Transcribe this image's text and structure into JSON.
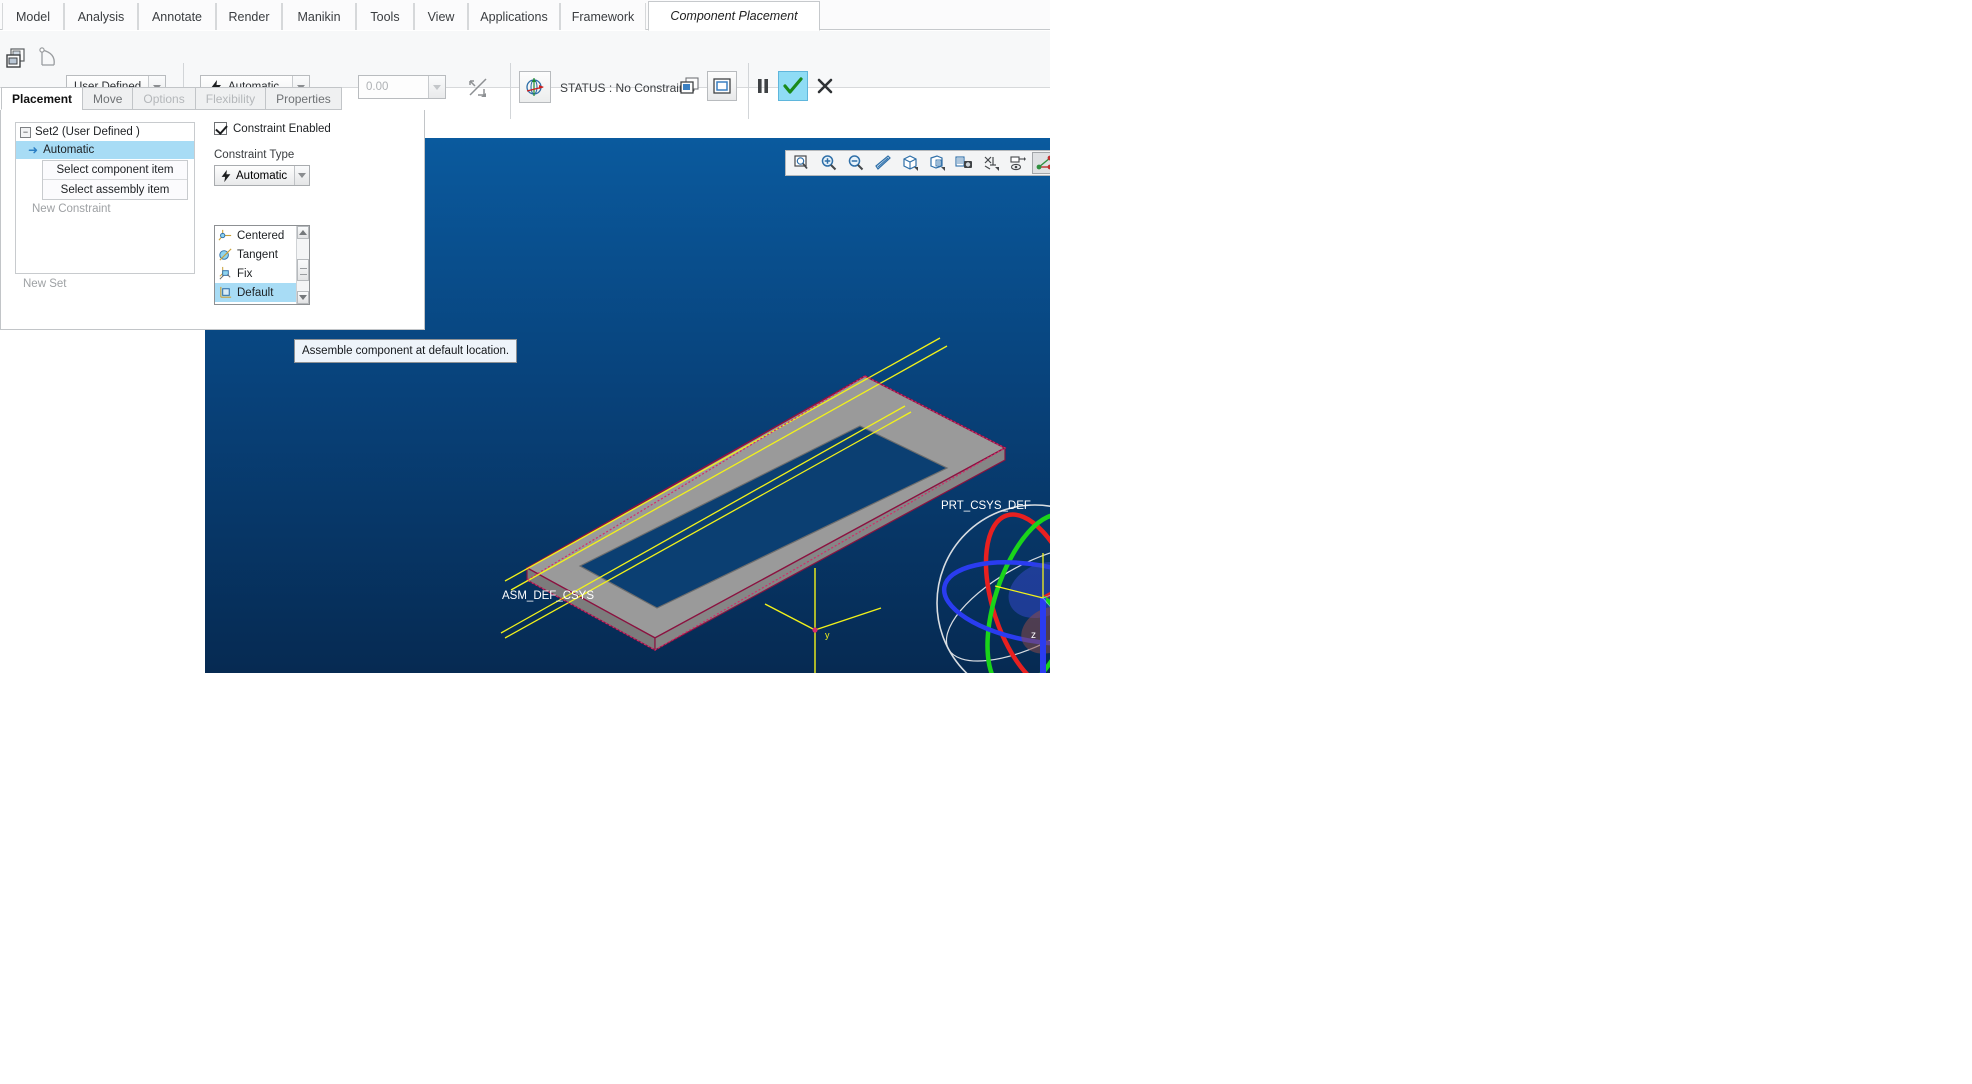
{
  "ribbon": {
    "tabs": [
      {
        "label": "Model",
        "active": false
      },
      {
        "label": "Analysis",
        "active": false
      },
      {
        "label": "Annotate",
        "active": false
      },
      {
        "label": "Render",
        "active": false
      },
      {
        "label": "Manikin",
        "active": false
      },
      {
        "label": "Tools",
        "active": false
      },
      {
        "label": "View",
        "active": false
      },
      {
        "label": "Applications",
        "active": false
      },
      {
        "label": "Framework",
        "active": false
      },
      {
        "label": "Component Placement",
        "active": true
      }
    ]
  },
  "toolbar": {
    "placement_mode_value": "User Defined",
    "constraint_type_value": "Automatic",
    "offset_value": "0.00",
    "status_text": "STATUS : No Constraints",
    "pause_label": "Pause",
    "ok_label": "OK",
    "cancel_label": "Cancel",
    "icons": {
      "placement_window": "placement-window-icon",
      "move_component": "move-component-icon",
      "constraint_bolt": "constraint-bolt-icon",
      "offset_flip": "flip-offset-icon",
      "drag_handle": "drag-handle-icon",
      "separate_window": "separate-window-icon",
      "assembly_window": "assembly-window-icon"
    }
  },
  "panel": {
    "tabs": [
      {
        "label": "Placement",
        "state": "active"
      },
      {
        "label": "Move",
        "state": "enabled"
      },
      {
        "label": "Options",
        "state": "disabled"
      },
      {
        "label": "Flexibility",
        "state": "disabled"
      },
      {
        "label": "Properties",
        "state": "enabled"
      }
    ],
    "tree": {
      "set_label": "Set2 (User Defined )",
      "expander_glyph": "−",
      "constraint_label": "Automatic",
      "select_component_label": "Select component item",
      "select_assembly_label": "Select assembly item",
      "new_constraint_label": "New Constraint",
      "new_set_label": "New Set"
    },
    "constraint_enabled_label": "Constraint Enabled",
    "constraint_type_label": "Constraint Type",
    "constraint_type_value": "Automatic",
    "dropdown_options": [
      {
        "label": "Centered",
        "icon": "centered-icon",
        "selected": false
      },
      {
        "label": "Tangent",
        "icon": "tangent-icon",
        "selected": false
      },
      {
        "label": "Fix",
        "icon": "fix-icon",
        "selected": false
      },
      {
        "label": "Default",
        "icon": "default-icon",
        "selected": true
      }
    ]
  },
  "tooltip": {
    "text": "Assemble component at default location."
  },
  "viewport": {
    "graphics_toolbar": [
      {
        "name": "refit-icon",
        "pressed": false
      },
      {
        "name": "zoom-in-icon",
        "pressed": false
      },
      {
        "name": "zoom-out-icon",
        "pressed": false
      },
      {
        "name": "repaint-icon",
        "pressed": false
      },
      {
        "name": "named-views-icon",
        "pressed": false
      },
      {
        "name": "view-manager-icon",
        "pressed": false
      },
      {
        "name": "saved-snapshot-icon",
        "pressed": false
      },
      {
        "name": "datum-display-icon",
        "pressed": false
      },
      {
        "name": "annotation-display-icon",
        "pressed": false
      },
      {
        "name": "csys-display-icon",
        "pressed": true
      }
    ],
    "labels": {
      "assembly_csys": "ASM_DEF_CSYS",
      "part_csys": "PRT_CSYS_DEF",
      "axis_y": "y",
      "axis_z": "z"
    },
    "colors": {
      "background_top": "#0a5a9e",
      "background_bottom": "#062a52",
      "part_face": "#9a9a9a",
      "part_edge": "#8b1240",
      "datum_yellow": "#f2f21a",
      "handle_x": "#e82020",
      "handle_y": "#1ad41a",
      "handle_z": "#2a3cf0",
      "highlight_ring": "#d8dde2"
    }
  }
}
